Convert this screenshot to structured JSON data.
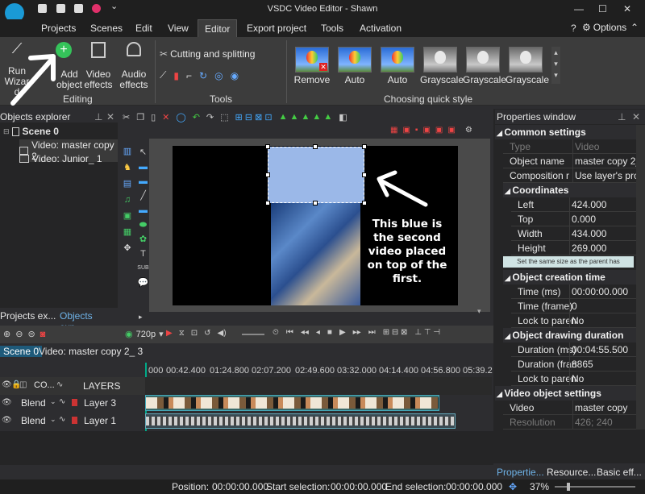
{
  "window": {
    "title": "VSDC Video Editor - Shawn",
    "options_label": "Options"
  },
  "menu": [
    "Projects",
    "Scenes",
    "Edit",
    "View",
    "Editor",
    "Export project",
    "Tools",
    "Activation"
  ],
  "ribbon": {
    "run_wizard": "Run Wizard",
    "add_object": "Add object",
    "video_effects": "Video effects",
    "audio_effects": "Audio effects",
    "editing_label": "Editing",
    "cutting_label": "Cutting and splitting",
    "tools_label": "Tools",
    "quick_style_label": "Choosing quick style",
    "quick_styles": [
      "Remove",
      "Auto",
      "Auto",
      "Grayscale",
      "Grayscale",
      "Grayscale"
    ]
  },
  "objects_explorer": {
    "title": "Objects explorer",
    "scene": "Scene 0",
    "items": [
      "Video: master copy 2",
      "Video: Junior_ 1"
    ],
    "tabs": [
      "Projects ex...",
      "Objects exp..."
    ]
  },
  "preview": {
    "annotation": "This blue is the second video placed on top of the first."
  },
  "properties": {
    "title": "Properties window",
    "common_settings": "Common settings",
    "type_label": "Type",
    "type_value": "Video",
    "object_name_label": "Object name",
    "object_name_value": "master copy 2_",
    "composition_label": "Composition mo",
    "composition_value": "Use layer's prop",
    "coordinates": "Coordinates",
    "left_label": "Left",
    "left_value": "424.000",
    "top_label": "Top",
    "top_value": "0.000",
    "width_label": "Width",
    "width_value": "434.000",
    "height_label": "Height",
    "height_value": "269.000",
    "same_size_button": "Set the same size as the parent has",
    "creation_time": "Object creation time",
    "time_ms_label": "Time (ms)",
    "time_ms_value": "00:00:00.000",
    "time_frame_label": "Time (frame)",
    "time_frame_value": "0",
    "lock_parent_label": "Lock to parent",
    "lock_parent_value": "No",
    "drawing_duration": "Object drawing duration",
    "duration_ms_label": "Duration (ms)",
    "duration_ms_value": "00:04:55.500",
    "duration_frame_label": "Duration (fran",
    "duration_frame_value": "8865",
    "lock_parent2_label": "Lock to parent",
    "lock_parent2_value": "No",
    "video_settings": "Video object settings",
    "video_label": "Video",
    "video_value": "master copy",
    "resolution_label": "Resolution",
    "resolution_value": "426; 240",
    "bottom_tabs": [
      "Propertie...",
      "Resource...",
      "Basic eff..."
    ]
  },
  "timeline": {
    "resolution": "720p",
    "tabs": [
      "Scene 0",
      "Video: master copy 2_ 3"
    ],
    "ruler": [
      "000",
      "00:42.400",
      "01:24.800",
      "02:07.200",
      "02:49.600",
      "03:32.000",
      "04:14.400",
      "04:56.800",
      "05:39.2"
    ],
    "layers_header": "LAYERS",
    "co_label": "CO...",
    "layers": [
      {
        "blend": "Blend",
        "name": "Layer 3"
      },
      {
        "blend": "Blend",
        "name": "Layer 1"
      }
    ]
  },
  "status": {
    "position_label": "Position:",
    "position_value": "00:00:00.000",
    "start_label": "Start selection:",
    "start_value": "00:00:00.000",
    "end_label": "End selection:",
    "end_value": "00:00:00.000",
    "zoom": "37%"
  }
}
